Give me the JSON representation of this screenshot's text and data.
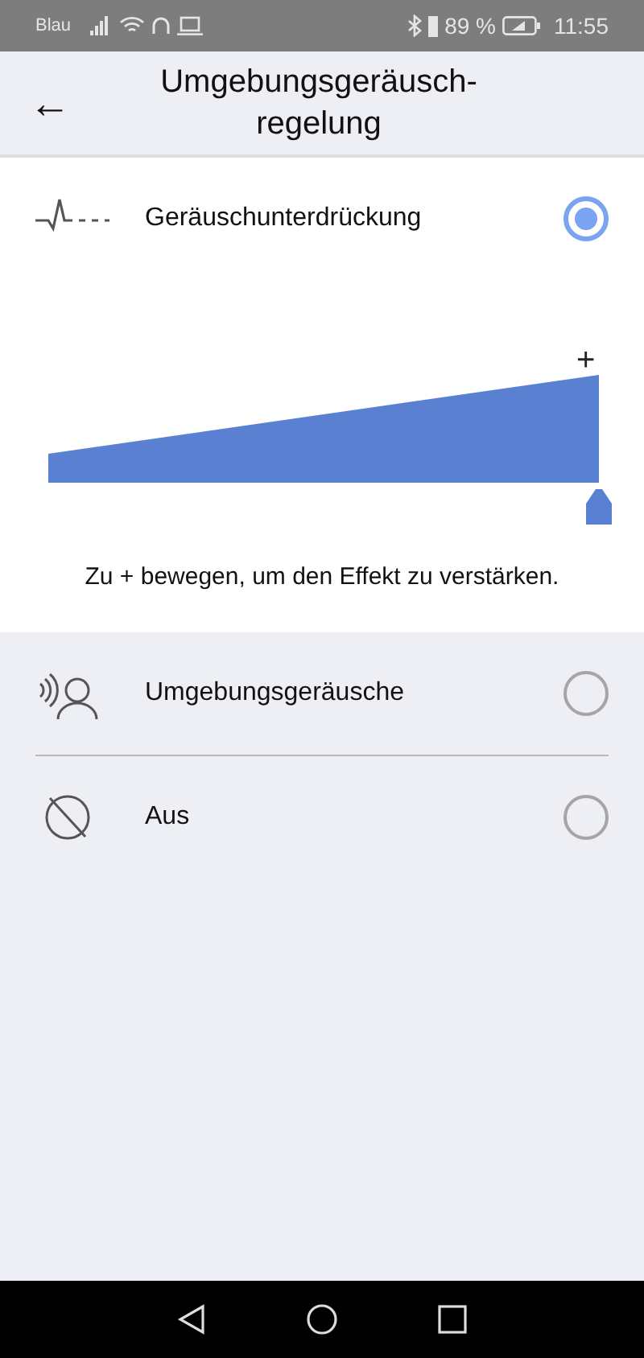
{
  "status_bar": {
    "carrier": "Blau",
    "battery": "89 %",
    "time": "11:55"
  },
  "header": {
    "back": "←",
    "title": "Umgebungsgeräusch-\nregelung"
  },
  "options": [
    {
      "kind": "noise",
      "label": "Geräuschunterdrückung",
      "selected": true,
      "slider": {
        "plus": "+"
      },
      "hint": "Zu + bewegen, um den Effekt zu verstärken."
    },
    {
      "kind": "ambient",
      "label": "Umgebungsgeräusche",
      "selected": false
    },
    {
      "kind": "off",
      "label": "Aus",
      "selected": false
    }
  ]
}
